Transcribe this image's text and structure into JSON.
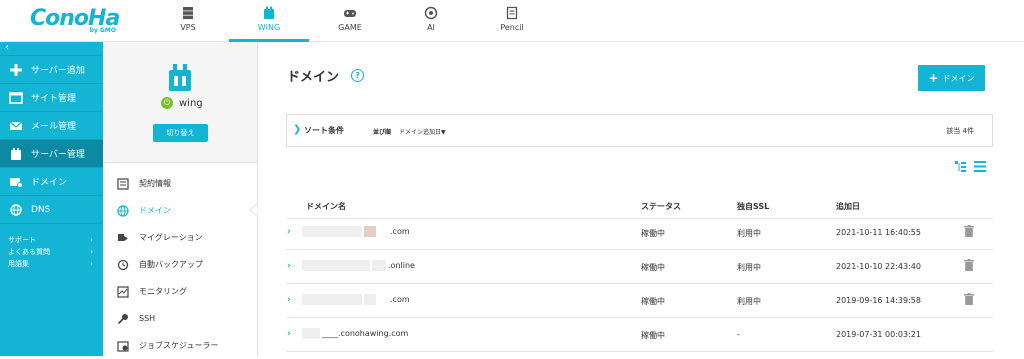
{
  "app": {
    "logo_text": "ConoHa",
    "logo_sub": "by GMO"
  },
  "topnav": [
    {
      "label": "VPS",
      "icon": "server-icon",
      "active": false
    },
    {
      "label": "WING",
      "icon": "wing-icon",
      "active": true
    },
    {
      "label": "GAME",
      "icon": "gamepad-icon",
      "active": false
    },
    {
      "label": "AI",
      "icon": "ai-icon",
      "active": false
    },
    {
      "label": "Pencil",
      "icon": "pencil-icon",
      "active": false
    }
  ],
  "sidebar": {
    "collapse": "‹",
    "items": [
      {
        "label": "サーバー追加",
        "icon": "plus-icon"
      },
      {
        "label": "サイト管理",
        "icon": "window-icon"
      },
      {
        "label": "メール管理",
        "icon": "mail-icon"
      },
      {
        "label": "サーバー管理",
        "icon": "server-manage-icon",
        "active": true
      },
      {
        "label": "ドメイン",
        "icon": "domain-icon"
      },
      {
        "label": "DNS",
        "icon": "globe-icon"
      }
    ],
    "sub_items": [
      {
        "label": "サポート",
        "chevron": "›"
      },
      {
        "label": "よくある質問",
        "chevron": "›"
      },
      {
        "label": "用語集",
        "chevron": "›"
      }
    ]
  },
  "panel": {
    "service_name": "wing",
    "switch_label": "切り替え",
    "items": [
      {
        "label": "契約情報",
        "icon": "contract-icon"
      },
      {
        "label": "ドメイン",
        "icon": "globe-icon",
        "active": true
      },
      {
        "label": "マイグレーション",
        "icon": "migration-icon"
      },
      {
        "label": "自動バックアップ",
        "icon": "backup-icon"
      },
      {
        "label": "モニタリング",
        "icon": "monitor-icon"
      },
      {
        "label": "SSH",
        "icon": "key-icon"
      },
      {
        "label": "ジョブスケジューラー",
        "icon": "scheduler-icon"
      }
    ]
  },
  "main": {
    "title": "ドメイン",
    "help": "?",
    "add_button": "ドメイン",
    "sort": {
      "title": "ソート条件",
      "order_label": "並び順",
      "order_value": "ドメイン追加日▼",
      "count": "該当 4件"
    },
    "columns": [
      "ドメイン名",
      "ステータス",
      "独自SSL",
      "追加日"
    ],
    "rows": [
      {
        "domain": ".com",
        "status": "稼働中",
        "ssl": "利用中",
        "date": "2021-10-11 16:40:55",
        "deletable": true
      },
      {
        "domain": ".online",
        "status": "稼働中",
        "ssl": "利用中",
        "date": "2021-10-10 22:43:40",
        "deletable": true
      },
      {
        "domain": ".com",
        "status": "稼働中",
        "ssl": "利用中",
        "date": "2019-09-16 14:39:58",
        "deletable": true
      },
      {
        "domain": "____.conohawing.com",
        "status": "稼働中",
        "ssl": "-",
        "date": "2019-07-31 00:03:21",
        "deletable": false
      }
    ]
  },
  "colors": {
    "accent": "#14b4d4",
    "sidebar_active": "#0c8aa4",
    "power_green": "#7cbf2c"
  }
}
